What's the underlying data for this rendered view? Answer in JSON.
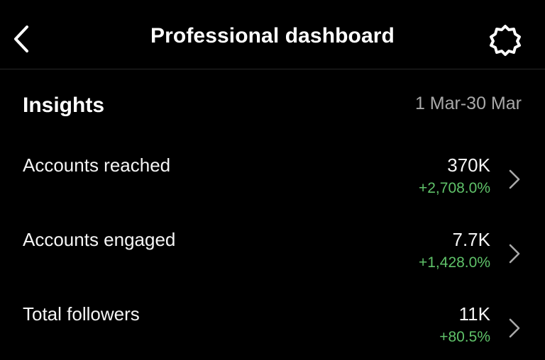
{
  "header": {
    "title": "Professional dashboard",
    "back_icon": "chevron-left-icon",
    "settings_icon": "gear-icon"
  },
  "insights": {
    "title": "Insights",
    "date_range": "1 Mar-30 Mar",
    "rows": [
      {
        "label": "Accounts reached",
        "value": "370K",
        "change": "+2,708.0%"
      },
      {
        "label": "Accounts engaged",
        "value": "7.7K",
        "change": "+1,428.0%"
      },
      {
        "label": "Total followers",
        "value": "11K",
        "change": "+80.5%"
      }
    ]
  },
  "colors": {
    "background": "#000000",
    "text": "#ffffff",
    "muted": "#a8a8a8",
    "positive": "#5fc269"
  }
}
